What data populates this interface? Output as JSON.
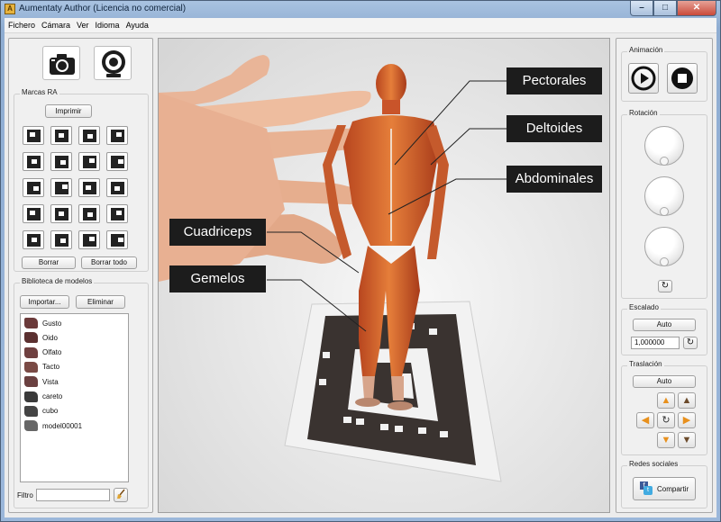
{
  "window": {
    "title": "Aumentaty Author (Licencia no comercial)",
    "icon": "app-icon"
  },
  "menu": [
    "Fichero",
    "Cámara",
    "Ver",
    "Idioma",
    "Ayuda"
  ],
  "left": {
    "camera_icon": "camera-icon",
    "webcam_icon": "webcam-icon",
    "markers_title": "Marcas RA",
    "print_label": "Imprimir",
    "clear_label": "Borrar",
    "clear_all_label": "Borrar todo",
    "library_title": "Biblioteca de modelos",
    "import_label": "Importar...",
    "delete_label": "Eliminar",
    "models": [
      {
        "name": "Gusto",
        "color": "#6b3a3a"
      },
      {
        "name": "Oido",
        "color": "#5b3030"
      },
      {
        "name": "Olfato",
        "color": "#6f4040"
      },
      {
        "name": "Tacto",
        "color": "#7a4a45"
      },
      {
        "name": "Vista",
        "color": "#6a4040"
      },
      {
        "name": "careto",
        "color": "#3a3a3a"
      },
      {
        "name": "cubo",
        "color": "#444444"
      },
      {
        "name": "model00001",
        "color": "#666666"
      }
    ],
    "filter_label": "Filtro",
    "filter_value": "",
    "broom_icon": "broom-icon"
  },
  "view": {
    "labels": [
      "Pectorales",
      "Deltoides",
      "Abdominales",
      "Cuadriceps",
      "Gemelos"
    ]
  },
  "right": {
    "animation_title": "Animación",
    "play_icon": "play-icon",
    "stop_icon": "stop-icon",
    "rotation_title": "Rotación",
    "reset_icon": "reset-icon",
    "scale_title": "Escalado",
    "scale_auto": "Auto",
    "scale_value": "1,000000",
    "translation_title": "Traslación",
    "translation_auto": "Auto",
    "social_title": "Redes sociales",
    "share_label": "Compartir",
    "facebook_icon": "facebook-icon",
    "twitter_icon": "twitter-icon"
  },
  "colors": {
    "accent_orange": "#e8901c",
    "label_bg": "#1c1c1c"
  }
}
